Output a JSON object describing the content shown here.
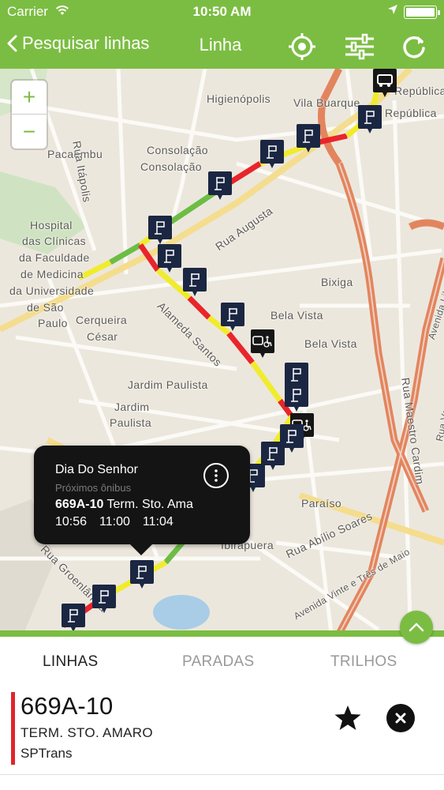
{
  "status_bar": {
    "carrier": "Carrier",
    "time": "10:50 AM"
  },
  "nav": {
    "back_label": "Pesquisar linhas",
    "title": "Linha",
    "icons": [
      "location-target-icon",
      "filter-sliders-icon",
      "refresh-icon"
    ]
  },
  "map": {
    "zoom_in": "+",
    "zoom_out": "−",
    "labels": {
      "higienopolis": "Higienópolis",
      "vila_buarque": "Vila Buarque",
      "republica_1": "República",
      "republica_2": "República",
      "pacaembu": "Pacaembu",
      "rua_itapolis": "Rua Itápolis",
      "consolacao_1": "Consolação",
      "consolacao_2": "Consolação",
      "rua_augusta": "Rua Augusta",
      "hospital_1": "Hospital",
      "hospital_2": "das Clínicas",
      "hospital_3": "da Faculdade",
      "hospital_4": "de Medicina",
      "hospital_5": "da Universidade",
      "hospital_6": "de São",
      "hospital_7": "Paulo",
      "cerqueira_1": "Cerqueira",
      "cerqueira_2": "César",
      "alameda_santos": "Alameda Santos",
      "bixiga": "Bixiga",
      "bela_vista_1": "Bela Vista",
      "bela_vista_2": "Bela Vista",
      "jardim_paulista_1": "Jardim Paulista",
      "jardim_paulista_2": "Jardim",
      "jardim_paulista_3": "Paulista",
      "rua_maestro": "Rua Maestro Cardim",
      "rua_vergueiro": "Rua Vergueiro",
      "avenida_liberdade": "Avenida Liberdade",
      "paraiso": "Paraíso",
      "rua_abilio": "Rua Abílio Soares",
      "ibirapuera": "Ibirapuera",
      "rua_groenlandia": "Rua Groenlândia",
      "avenida_23": "Avenida Vinte e Três de Maio"
    },
    "colors": {
      "route_green": "#6dbd45",
      "route_yellow": "#f0ec2c",
      "route_red": "#e8252b",
      "stop_marker": "#1b2742"
    }
  },
  "popup": {
    "stop_name": "Dia Do Senhor",
    "subtitle": "Próximos ônibus",
    "line_code": "669A-10",
    "line_dest": "Term. Sto. Ama",
    "times": [
      "10:56",
      "11:00",
      "11:04"
    ]
  },
  "tabs": [
    "LINHAS",
    "PARADAS",
    "TRILHOS"
  ],
  "route": {
    "code": "669A-10",
    "destination": "TERM. STO. AMARO",
    "operator": "SPTrans",
    "color": "#e3242b"
  },
  "theme": {
    "accent": "#7bbd42"
  }
}
